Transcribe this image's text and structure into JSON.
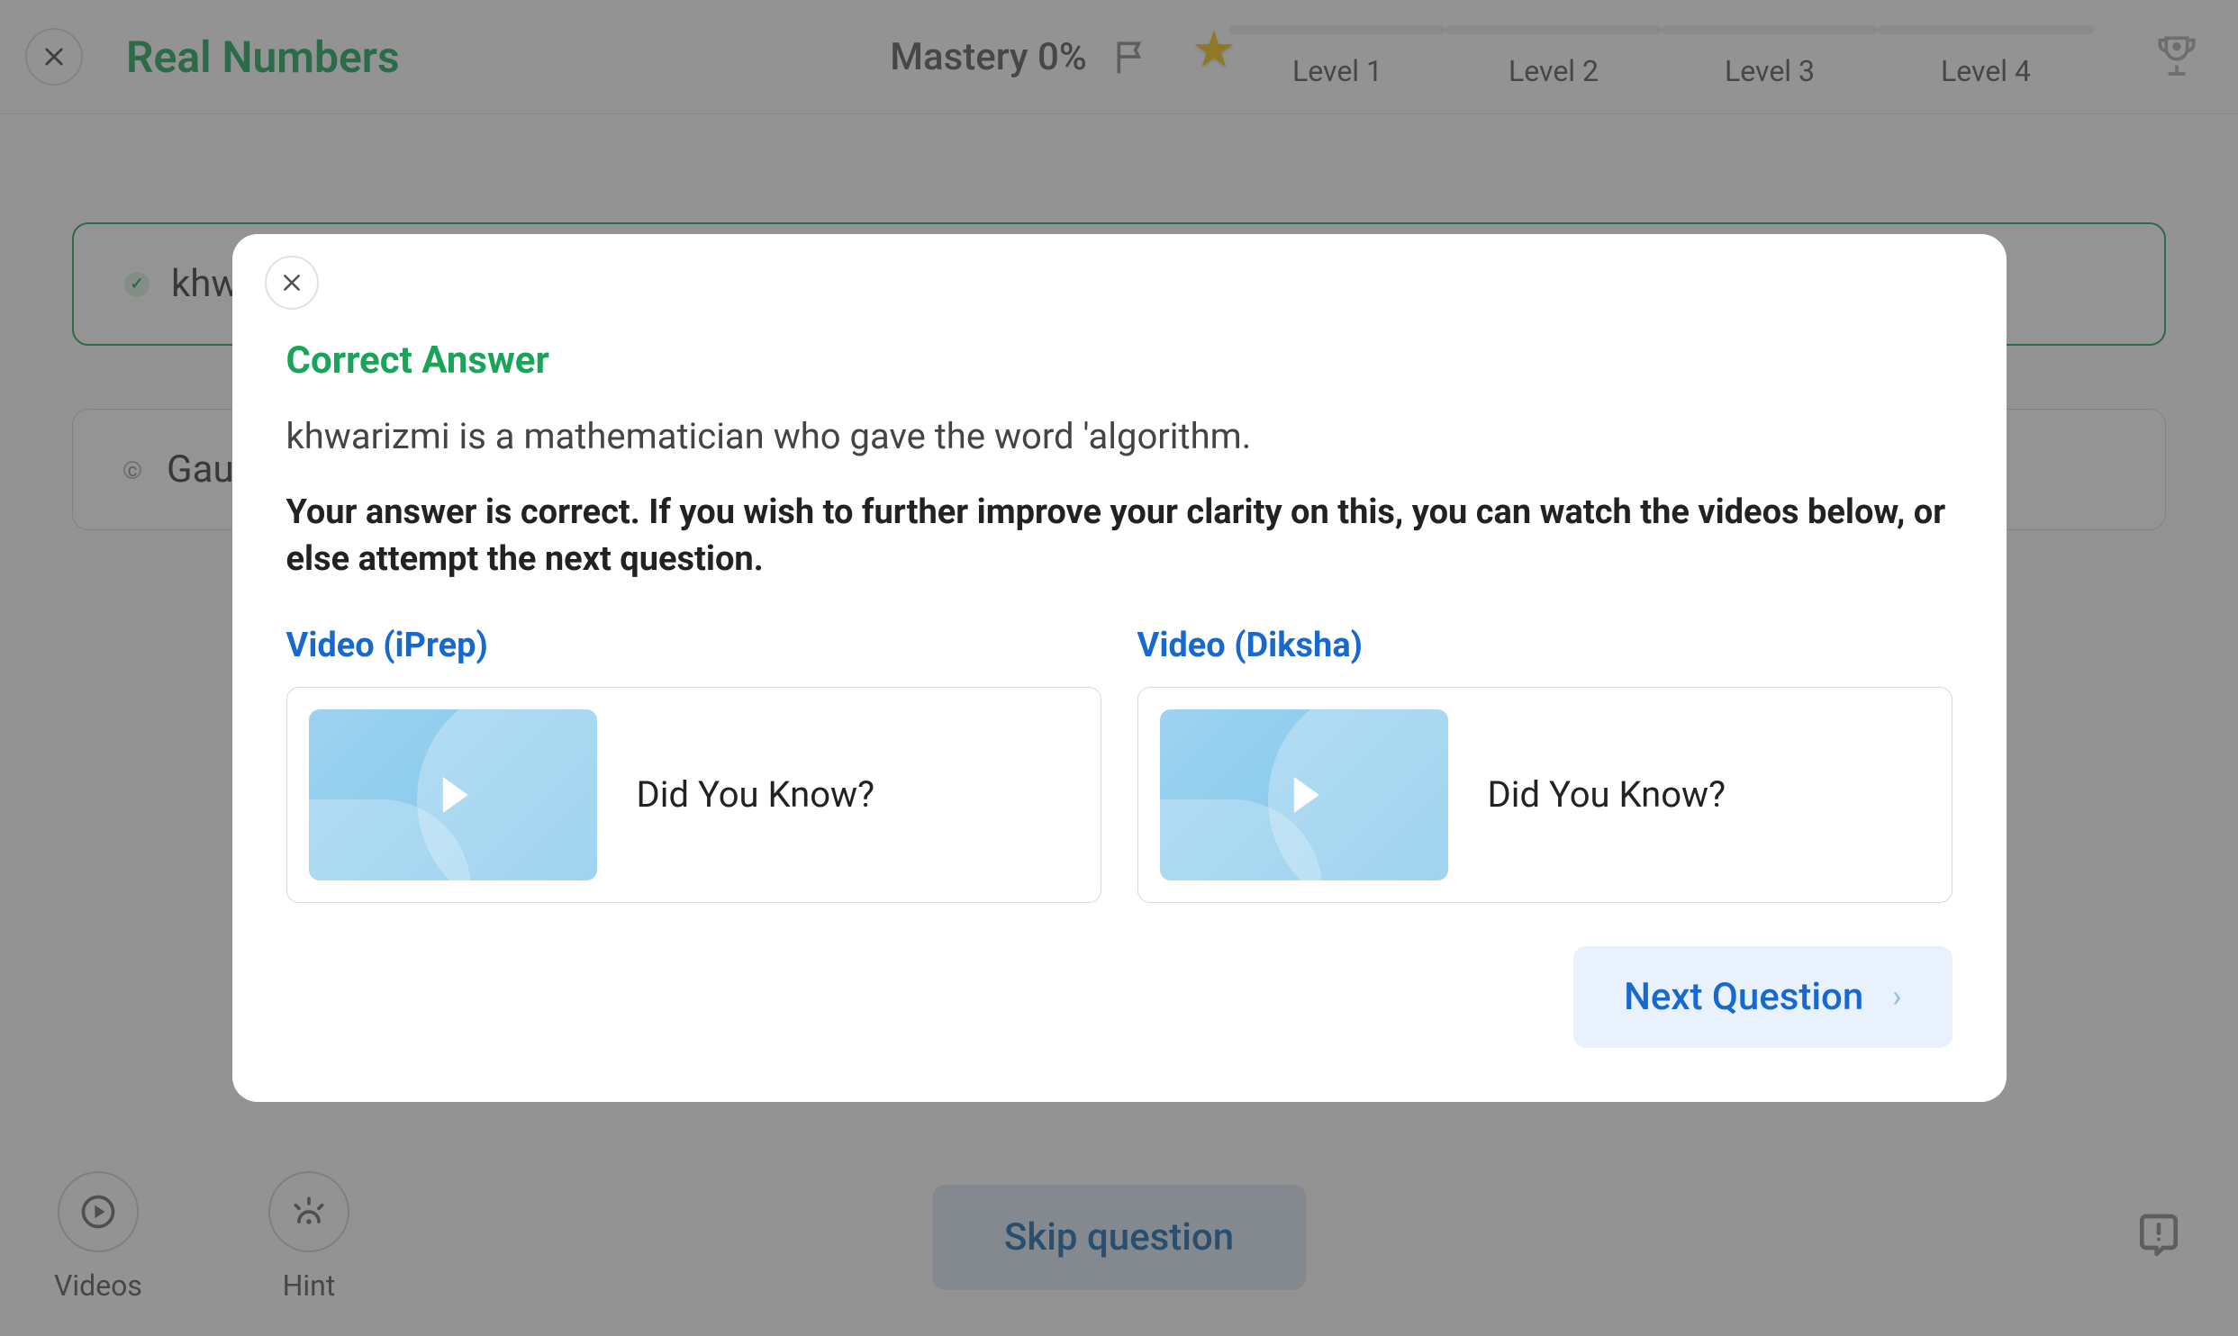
{
  "header": {
    "title": "Real Numbers",
    "mastery_label": "Mastery 0%",
    "levels": [
      "Level 1",
      "Level 2",
      "Level 3",
      "Level 4"
    ]
  },
  "options": {
    "selected_prefix": "khwa",
    "other_prefix": "Gaus",
    "other_letter": "c"
  },
  "footer": {
    "videos_label": "Videos",
    "hint_label": "Hint",
    "skip_label": "Skip question"
  },
  "modal": {
    "title": "Correct Answer",
    "answer_text": "khwarizmi is a mathematician who gave the word 'algorithm.",
    "description": "Your answer is correct. If you wish to further improve your clarity on this, you can watch the videos below, or else attempt the next question.",
    "videos": [
      {
        "heading": "Video (iPrep)",
        "title": "Did You Know?"
      },
      {
        "heading": "Video (Diksha)",
        "title": "Did You Know?"
      }
    ],
    "next_label": "Next Question"
  }
}
